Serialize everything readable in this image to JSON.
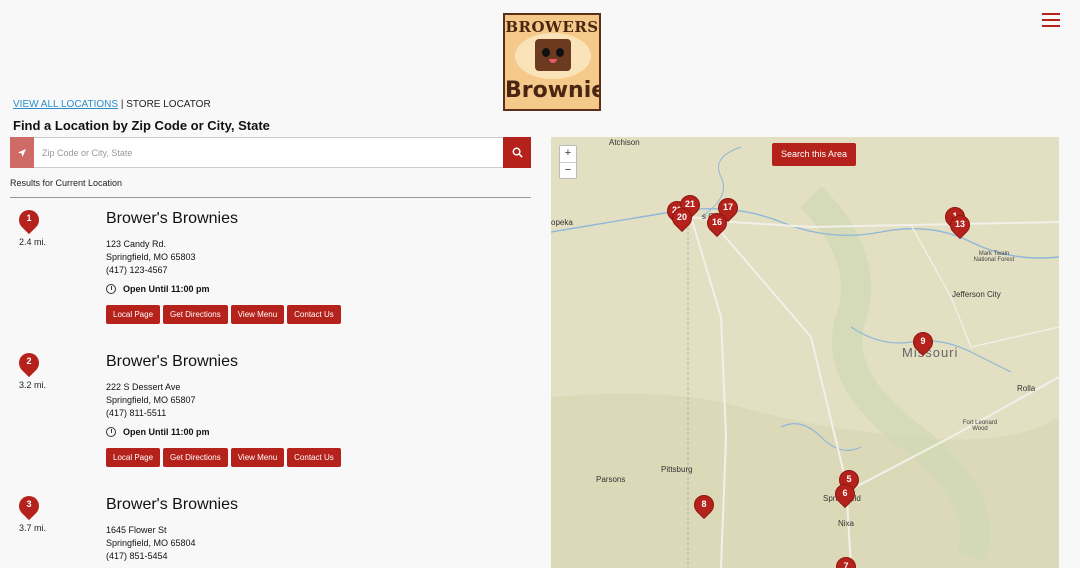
{
  "header": {
    "logo": {
      "top_text": "BROWERS",
      "bottom_text": "Brownie"
    },
    "menu_icon": "hamburger-icon"
  },
  "breadcrumb": {
    "link": "VIEW ALL LOCATIONS",
    "separator": "|",
    "current": "STORE LOCATOR"
  },
  "finder": {
    "title": "Find a Location by Zip Code or City, State",
    "search_placeholder": "Zip Code or City, State",
    "results_label": "Results for Current Location"
  },
  "results": [
    {
      "num": "1",
      "distance": "2.4 mi.",
      "name": "Brower's Brownies",
      "street": "123 Candy Rd.",
      "city": "Springfield, MO 65803",
      "phone": "(417) 123-4567",
      "hours": "Open Until 11:00 pm"
    },
    {
      "num": "2",
      "distance": "3.2 mi.",
      "name": "Brower's Brownies",
      "street": "222 S Dessert Ave",
      "city": "Springfield, MO 65807",
      "phone": "(417) 811-5511",
      "hours": "Open Until 11:00 pm"
    },
    {
      "num": "3",
      "distance": "3.7 mi.",
      "name": "Brower's Brownies",
      "street": "1645 Flower St",
      "city": "Springfield, MO 65804",
      "phone": "(417) 851-5454",
      "hours": ""
    }
  ],
  "result_buttons": {
    "local_page": "Local Page",
    "directions": "Get Directions",
    "menu": "View Menu",
    "contact": "Contact Us"
  },
  "map": {
    "zoom_in": "+",
    "zoom_out": "−",
    "search_area": "Search this Area",
    "labels": {
      "atchison": "Atchison",
      "topeka": "opeka",
      "kc_tail": "s City",
      "jefferson": "Jefferson City",
      "mark_twain": "Mark Twain National Forest",
      "missouri": "Missouri",
      "rolla": "Rolla",
      "fort_leonard": "Fort Leonard Wood",
      "pittsburg": "Pittsburg",
      "parsons": "Parsons",
      "springfield": "Springfield",
      "nixa": "Nixa"
    },
    "pins": [
      "23",
      "21",
      "20",
      "17",
      "16",
      "1",
      "13",
      "9",
      "5",
      "6",
      "8",
      "7"
    ]
  },
  "colors": {
    "brand_red": "#b5211b",
    "map_bg": "#e6e2c8",
    "link_blue": "#2a8fc9"
  }
}
